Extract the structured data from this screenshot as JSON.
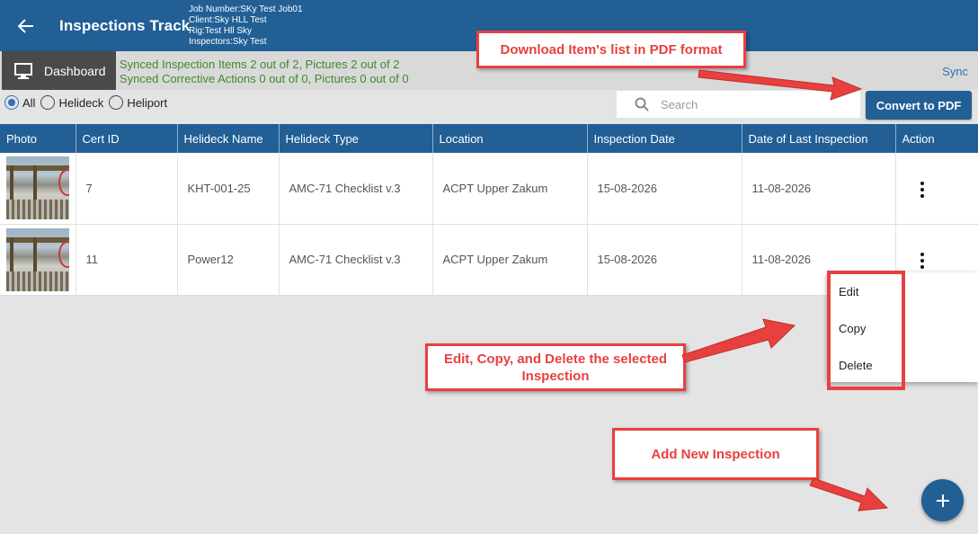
{
  "header": {
    "title": "Inspections Track",
    "job_number": "Job Number:SKy Test Job01",
    "client": "Client:Sky HLL Test",
    "rig": "Rig:Test Hll Sky",
    "inspectors": "Inspectors:Sky Test"
  },
  "toolbar": {
    "dashboard_label": "Dashboard",
    "sync_items": "Synced Inspection Items 2 out of 2, Pictures 2 out of 2",
    "sync_actions": "Synced Corrective Actions 0 out of 0, Pictures 0 out of 0",
    "sync_label": "Sync"
  },
  "filters": {
    "options": [
      "All",
      "Helideck",
      "Heliport"
    ],
    "selected": "All"
  },
  "search": {
    "placeholder": "Search",
    "value": ""
  },
  "convert_button": "Convert to PDF",
  "table": {
    "columns": [
      "Photo",
      "Cert ID",
      "Helideck Name",
      "Helideck Type",
      "Location",
      "Inspection Date",
      "Date of Last Inspection",
      "Action"
    ],
    "rows": [
      {
        "cert_id": "7",
        "name": "KHT-001-25",
        "type": "AMC-71 Checklist v.3",
        "location": "ACPT Upper Zakum",
        "inspection_date": "15-08-2026",
        "last_inspection": "11-08-2026"
      },
      {
        "cert_id": "11",
        "name": "Power12",
        "type": "AMC-71 Checklist v.3",
        "location": "ACPT Upper Zakum",
        "inspection_date": "15-08-2026",
        "last_inspection": "11-08-2026"
      }
    ]
  },
  "context_menu": {
    "items": [
      "Edit",
      "Copy",
      "Delete"
    ]
  },
  "callouts": {
    "pdf": "Download Item's list in PDF format",
    "edit_line1": "Edit, Copy, and Delete the selected",
    "edit_line2": "Inspection",
    "add": "Add New Inspection"
  },
  "fab_icon": "plus-icon",
  "colors": {
    "primary": "#215f95",
    "sync_text": "#3f8a29",
    "callout": "#e8403f",
    "link": "#2e72b8"
  }
}
